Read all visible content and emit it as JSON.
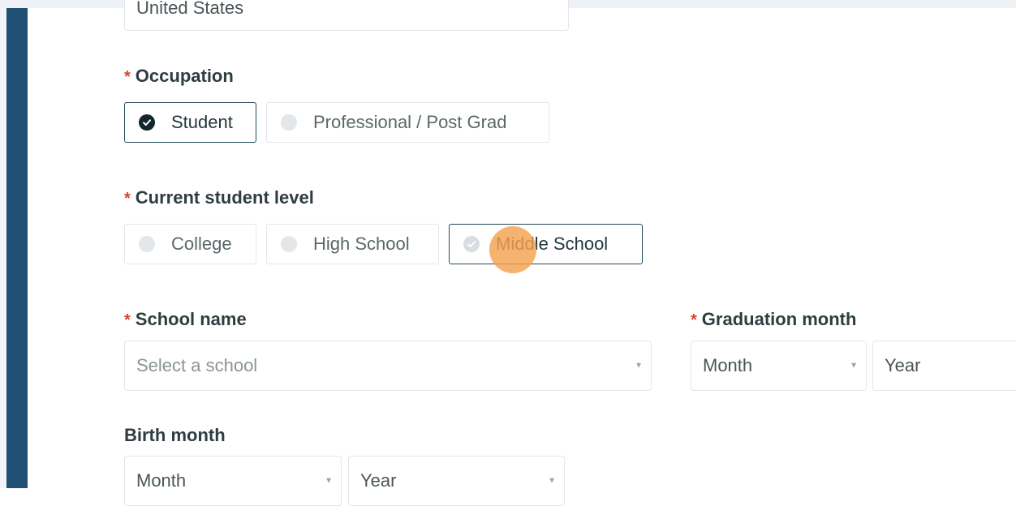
{
  "country": {
    "value": "United States"
  },
  "occupation": {
    "required_mark": "*",
    "label": "Occupation",
    "options": [
      {
        "label": "Student",
        "selected": true
      },
      {
        "label": "Professional / Post Grad",
        "selected": false
      }
    ]
  },
  "student_level": {
    "required_mark": "*",
    "label": "Current student level",
    "options": [
      {
        "label": "College",
        "selected": false
      },
      {
        "label": "High School",
        "selected": false
      },
      {
        "label": "Middle School",
        "selected": true
      }
    ]
  },
  "school": {
    "required_mark": "*",
    "label": "School name",
    "placeholder": "Select a school"
  },
  "graduation": {
    "required_mark": "*",
    "label": "Graduation month",
    "month_value": "Month",
    "year_value": "Year"
  },
  "birth": {
    "label": "Birth month",
    "month_value": "Month",
    "year_value": "Year"
  },
  "colors": {
    "sidebar": "#1f4f72",
    "required": "#d9442b",
    "selected_border": "#234a5a",
    "click_marker": "#f4a250"
  }
}
